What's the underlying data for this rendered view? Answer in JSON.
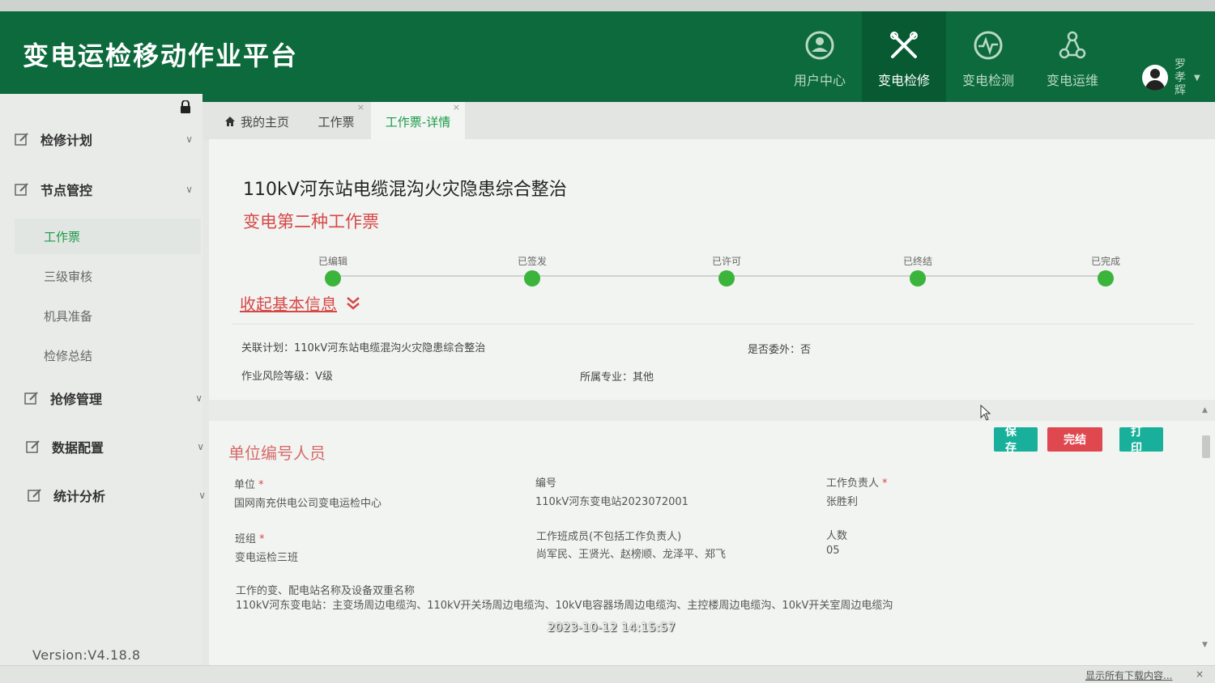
{
  "app": {
    "title": "变电运检移动作业平台"
  },
  "top_nav": [
    {
      "label": "用户中心",
      "icon": "user-center-icon"
    },
    {
      "label": "变电检修",
      "icon": "tools-icon",
      "active": true
    },
    {
      "label": "变电检测",
      "icon": "heartbeat-icon"
    },
    {
      "label": "变电运维",
      "icon": "operations-icon"
    }
  ],
  "user": {
    "name": "罗孝辉"
  },
  "sidebar": {
    "groups": [
      {
        "label": "检修计划"
      },
      {
        "label": "节点管控"
      },
      {
        "label": "抢修管理"
      },
      {
        "label": "数据配置"
      },
      {
        "label": "统计分析"
      }
    ],
    "sub_items": [
      {
        "label": "工作票",
        "active": true
      },
      {
        "label": "三级审核"
      },
      {
        "label": "机具准备"
      },
      {
        "label": "检修总结"
      }
    ],
    "version": "Version:V4.18.8"
  },
  "tabs": [
    {
      "label": "我的主页"
    },
    {
      "label": "工作票",
      "close": "×"
    },
    {
      "label": "工作票-详情",
      "close": "×",
      "active": true
    }
  ],
  "ticket": {
    "title": "110kV河东站电缆混沟火灾隐患综合整治",
    "type": "变电第二种工作票",
    "steps": [
      "已编辑",
      "已签发",
      "已许可",
      "已终结",
      "已完成"
    ],
    "toggle_label": "收起基本信息",
    "info": {
      "plan": "关联计划：110kV河东站电缆混沟火灾隐患综合整治",
      "outsourced": "是否委外：否",
      "risk": "作业风险等级：Ⅴ级",
      "specialty": "所属专业：其他"
    }
  },
  "section": {
    "title": "单位编号人员",
    "buttons": {
      "save": "保存",
      "finish": "完结",
      "print": "打印"
    },
    "fields": {
      "unit_label": "单位",
      "unit_value": "国网南充供电公司变电运检中心",
      "number_label": "编号",
      "number_value": "110kV河东变电站2023072001",
      "leader_label": "工作负责人",
      "leader_value": "张胜利",
      "team_label": "班组",
      "team_value": "变电运检三班",
      "members_label": "工作班成员(不包括工作负责人)",
      "members_value": "尚军民、王贤光、赵榜顺、龙泽平、郑飞",
      "count_label": "人数",
      "count_value": "05",
      "station_label": "工作的变、配电站名称及设备双重名称",
      "station_value": "110kV河东变电站：主变场周边电缆沟、110kV开关场周边电缆沟、10kV电容器场周边电缆沟、主控楼周边电缆沟、10kV开关室周边电缆沟"
    },
    "required_mark": "*"
  },
  "timestamp": "2023-10-12 14:15:57",
  "download_bar": {
    "text": "显示所有下载内容...",
    "close": "×"
  },
  "colors": {
    "header": "#0c6a3c",
    "accent": "#1a9a4a",
    "danger": "#e0484f",
    "teal": "#18b09a"
  }
}
